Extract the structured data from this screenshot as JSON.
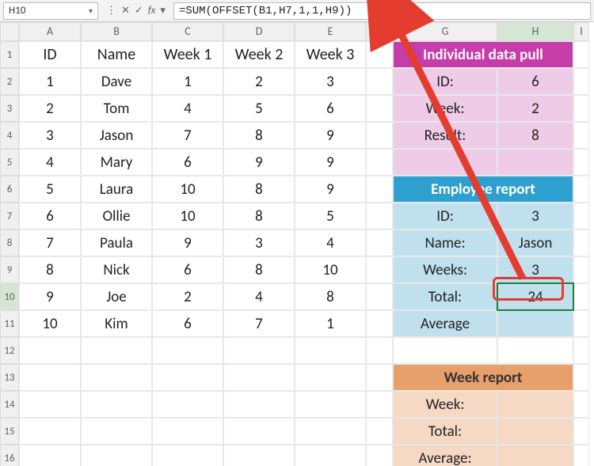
{
  "formulaBar": {
    "cellRef": "H10",
    "formula": "=SUM(OFFSET(B1,H7,1,1,H9))"
  },
  "columns": [
    "A",
    "B",
    "C",
    "D",
    "E",
    "F",
    "G",
    "H",
    "I"
  ],
  "headers": {
    "A": "ID",
    "B": "Name",
    "C": "Week 1",
    "D": "Week 2",
    "E": "Week 3"
  },
  "table": [
    {
      "id": "1",
      "name": "Dave",
      "w1": "1",
      "w2": "2",
      "w3": "3"
    },
    {
      "id": "2",
      "name": "Tom",
      "w1": "4",
      "w2": "5",
      "w3": "6"
    },
    {
      "id": "3",
      "name": "Jason",
      "w1": "7",
      "w2": "8",
      "w3": "9"
    },
    {
      "id": "4",
      "name": "Mary",
      "w1": "6",
      "w2": "9",
      "w3": "9"
    },
    {
      "id": "5",
      "name": "Laura",
      "w1": "10",
      "w2": "8",
      "w3": "9"
    },
    {
      "id": "6",
      "name": "Ollie",
      "w1": "10",
      "w2": "8",
      "w3": "5"
    },
    {
      "id": "7",
      "name": "Paula",
      "w1": "9",
      "w2": "3",
      "w3": "4"
    },
    {
      "id": "8",
      "name": "Nick",
      "w1": "6",
      "w2": "8",
      "w3": "10"
    },
    {
      "id": "9",
      "name": "Joe",
      "w1": "2",
      "w2": "4",
      "w3": "8"
    },
    {
      "id": "10",
      "name": "Kim",
      "w1": "6",
      "w2": "7",
      "w3": "1"
    }
  ],
  "panel1": {
    "title": "Individual data pull",
    "rows": [
      {
        "label": "ID:",
        "value": "6"
      },
      {
        "label": "Week:",
        "value": "2"
      },
      {
        "label": "Result:",
        "value": "8"
      }
    ]
  },
  "panel2": {
    "title": "Employee report",
    "rows": [
      {
        "label": "ID:",
        "value": "3"
      },
      {
        "label": "Name:",
        "value": "Jason"
      },
      {
        "label": "Weeks:",
        "value": "3"
      },
      {
        "label": "Total:",
        "value": "24"
      },
      {
        "label": "Average",
        "value": ""
      }
    ]
  },
  "panel3": {
    "title": "Week report",
    "rows": [
      {
        "label": "Week:",
        "value": ""
      },
      {
        "label": "Total:",
        "value": ""
      },
      {
        "label": "Average:",
        "value": ""
      }
    ]
  },
  "chart_data": {
    "type": "table",
    "columns": [
      "ID",
      "Name",
      "Week 1",
      "Week 2",
      "Week 3"
    ],
    "rows": [
      [
        1,
        "Dave",
        1,
        2,
        3
      ],
      [
        2,
        "Tom",
        4,
        5,
        6
      ],
      [
        3,
        "Jason",
        7,
        8,
        9
      ],
      [
        4,
        "Mary",
        6,
        9,
        9
      ],
      [
        5,
        "Laura",
        10,
        8,
        9
      ],
      [
        6,
        "Ollie",
        10,
        8,
        5
      ],
      [
        7,
        "Paula",
        9,
        3,
        4
      ],
      [
        8,
        "Nick",
        6,
        8,
        10
      ],
      [
        9,
        "Joe",
        2,
        4,
        8
      ],
      [
        10,
        "Kim",
        6,
        7,
        1
      ]
    ]
  }
}
